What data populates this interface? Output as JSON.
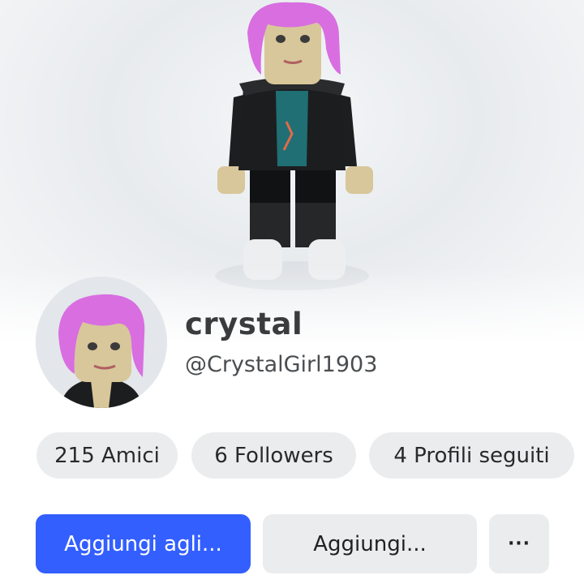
{
  "profile": {
    "display_name": "crystal",
    "username": "@CrystalGirl1903"
  },
  "stats": {
    "friends": "215 Amici",
    "followers": "6 Followers",
    "following": "4 Profili seguiti"
  },
  "actions": {
    "primary_label": "Aggiungi agli...",
    "secondary_label": "Aggiungi...",
    "more_label": "···"
  },
  "colors": {
    "primary": "#335fff",
    "pill_bg": "#eaecee",
    "hair": "#d86ee0",
    "text": "#393b3d"
  },
  "icons": {
    "avatar": "avatar-3d-figure",
    "profile_picture": "avatar-headshot",
    "more": "ellipsis-icon"
  }
}
